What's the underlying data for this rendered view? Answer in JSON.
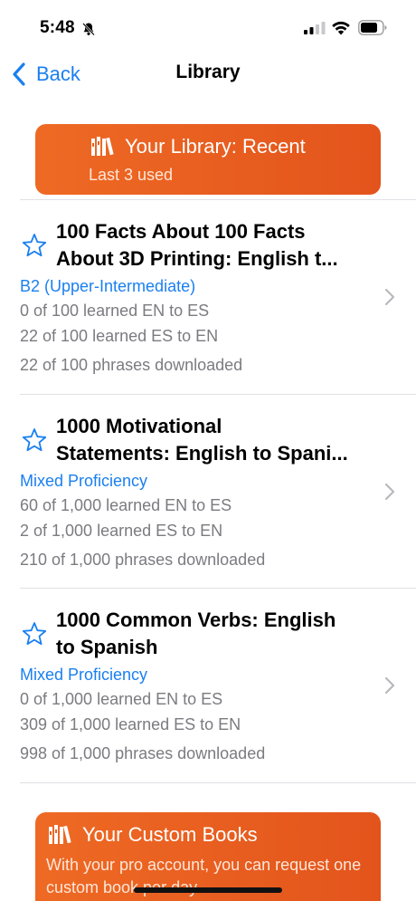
{
  "status_bar": {
    "time": "5:48"
  },
  "nav": {
    "back_label": "Back",
    "title": "Library"
  },
  "recent_banner": {
    "title": "Your Library: Recent",
    "subtitle": "Last 3 used"
  },
  "books": [
    {
      "title_line1": "100 Facts About 100 Facts",
      "title_line2": "About 3D Printing: English t...",
      "level": "B2 (Upper-Intermediate)",
      "learned_en_es": "0 of 100 learned EN to ES",
      "learned_es_en": "22 of 100 learned ES to EN",
      "downloaded": "22 of 100 phrases downloaded"
    },
    {
      "title_line1": "1000 Motivational",
      "title_line2": "Statements: English to Spani...",
      "level": "Mixed Proficiency",
      "learned_en_es": "60 of 1,000 learned EN to ES",
      "learned_es_en": "2 of 1,000 learned ES to EN",
      "downloaded": "210 of 1,000 phrases downloaded"
    },
    {
      "title_line1": "1000 Common Verbs: English",
      "title_line2": "to Spanish",
      "level": "Mixed Proficiency",
      "learned_en_es": "0 of 1,000 learned EN to ES",
      "learned_es_en": "309 of 1,000 learned ES to EN",
      "downloaded": "998 of 1,000 phrases downloaded"
    }
  ],
  "custom_banner": {
    "title": "Your Custom Books",
    "subtitle": "With your pro account, you can request one custom book per day"
  },
  "colors": {
    "accent": "#1a7ff0",
    "banner": "#e85f20",
    "secondary_text": "#7b7b80"
  },
  "icons": [
    "bell-slash-icon",
    "signal-icon",
    "wifi-icon",
    "battery-icon",
    "back-chevron-icon",
    "books-icon",
    "star-outline-icon",
    "chevron-right-icon"
  ]
}
